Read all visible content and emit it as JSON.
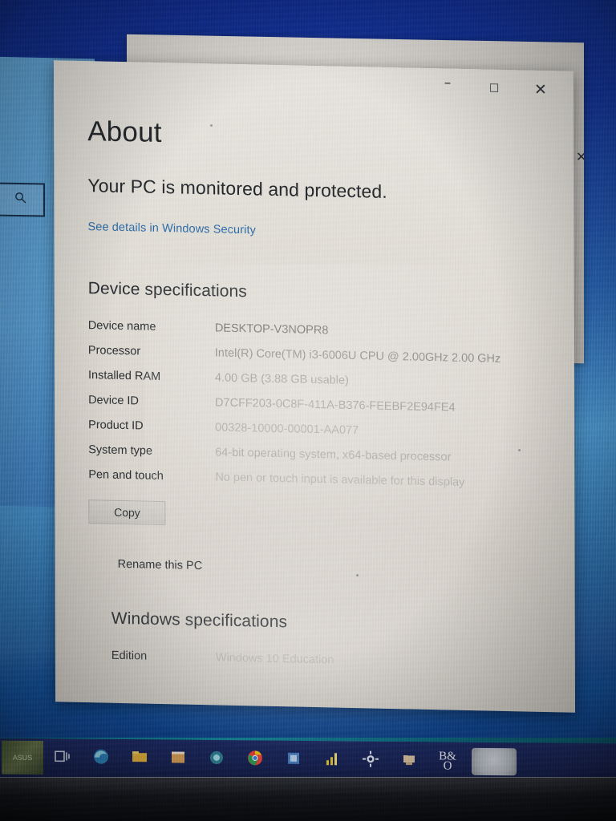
{
  "window": {
    "title_controls": {
      "minimize": "–",
      "maximize": "☐",
      "close": "✕"
    }
  },
  "background_window": {
    "close": "✕"
  },
  "desktop": {
    "search_icon": "search-icon"
  },
  "page": {
    "title": "About",
    "subtitle": "Your PC is monitored and protected.",
    "security_link": "See details in Windows Security"
  },
  "device_specifications": {
    "heading": "Device specifications",
    "rows": [
      {
        "label": "Device name",
        "value": "DESKTOP-V3NOPR8"
      },
      {
        "label": "Processor",
        "value": "Intel(R) Core(TM) i3-6006U CPU @ 2.00GHz   2.00 GHz"
      },
      {
        "label": "Installed RAM",
        "value": "4.00 GB (3.88 GB usable)"
      },
      {
        "label": "Device ID",
        "value": "D7CFF203-0C8F-411A-B376-FEEBF2E94FE4"
      },
      {
        "label": "Product ID",
        "value": "00328-10000-00001-AA077"
      },
      {
        "label": "System type",
        "value": "64-bit operating system, x64-based processor"
      },
      {
        "label": "Pen and touch",
        "value": "No pen or touch input is available for this display"
      }
    ],
    "copy_button": "Copy",
    "rename_button": "Rename this PC"
  },
  "windows_specifications": {
    "heading": "Windows specifications",
    "rows": [
      {
        "label": "Edition",
        "value": "Windows 10 Education"
      }
    ]
  },
  "taskbar": {
    "start_label": "ASUS",
    "items": [
      {
        "name": "task-view-icon",
        "glyph": "▣"
      },
      {
        "name": "edge-browser-icon",
        "glyph": "◑"
      },
      {
        "name": "file-explorer-icon",
        "glyph": "▤"
      },
      {
        "name": "store-icon",
        "glyph": "▥"
      },
      {
        "name": "app-icon-teal",
        "glyph": "◎"
      },
      {
        "name": "chrome-browser-icon",
        "glyph": "◉"
      },
      {
        "name": "app-icon-blue",
        "glyph": "▦"
      },
      {
        "name": "chart-app-icon",
        "glyph": "◥"
      },
      {
        "name": "settings-gear-icon",
        "glyph": "⚙"
      },
      {
        "name": "app-icon-tan",
        "glyph": "▧"
      },
      {
        "name": "bang-olufsen-icon",
        "glyph": "B&O"
      }
    ],
    "clock_name": "clock-area"
  }
}
